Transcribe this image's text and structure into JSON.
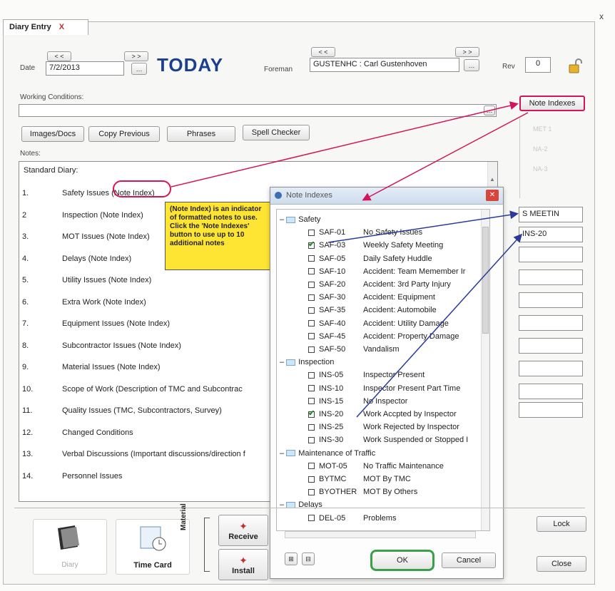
{
  "tab": {
    "label": "Diary Entry",
    "close": "X"
  },
  "window_close": "x",
  "header": {
    "date_label": "Date",
    "date_prev": "< <",
    "date_next": "> >",
    "date_value": "7/2/2013",
    "today_label": "TODAY",
    "foreman_label": "Foreman",
    "foreman_prev": "< <",
    "foreman_next": "> >",
    "foreman_value": "GUSTENHC : Carl Gustenhoven",
    "rev_label": "Rev",
    "rev_value": "0"
  },
  "working_conditions_label": "Working Conditions:",
  "toolbar": {
    "images_docs": "Images/Docs",
    "copy_previous": "Copy Previous",
    "phrases": "Phrases",
    "spell_checker": "Spell Checker"
  },
  "note_indexes_button": "Note Indexes",
  "notes_label": "Notes:",
  "standard_diary": "Standard Diary:",
  "notes": [
    {
      "num": "1.",
      "text": "Safety Issues (Note Index)"
    },
    {
      "num": "2",
      "text": "Inspection (Note Index)"
    },
    {
      "num": "3.",
      "text": "MOT Issues (Note Index)"
    },
    {
      "num": "4.",
      "text": "Delays (Note Index)"
    },
    {
      "num": "5.",
      "text": "Utility Issues (Note Index)"
    },
    {
      "num": "6.",
      "text": "Extra Work (Note Index)"
    },
    {
      "num": "7.",
      "text": "Equipment Issues (Note Index)"
    },
    {
      "num": "8.",
      "text": "Subcontractor Issues (Note Index)"
    },
    {
      "num": "9.",
      "text": "Material Issues (Note Index)"
    },
    {
      "num": "10.",
      "text": "Scope of Work (Description of TMC and Subcontrac"
    },
    {
      "num": "11.",
      "text": "Quality Issues (TMC, Subcontractors, Survey)"
    },
    {
      "num": "12.",
      "text": "Changed Conditions"
    },
    {
      "num": "13.",
      "text": "Verbal Discussions (Important discussions/direction f"
    },
    {
      "num": "14.",
      "text": "Personnel Issues"
    }
  ],
  "callout": "(Note Index) is an indicator of formatted notes to use. Click the 'Note Indexes' button to use up to 10 additional notes",
  "side_slots": [
    "S MEETIN",
    "INS-20"
  ],
  "side_faint": [
    "MET 1",
    "NA-2",
    "NA-3"
  ],
  "dialog": {
    "title": "Note Indexes",
    "close": "✕",
    "items": [
      {
        "kind": "group",
        "label": "Safety"
      },
      {
        "kind": "item",
        "code": "SAF-01",
        "label": "No Safety Issues",
        "checked": false
      },
      {
        "kind": "item",
        "code": "SAF-03",
        "label": "Weekly Safety Meeting",
        "checked": true
      },
      {
        "kind": "item",
        "code": "SAF-05",
        "label": "Daily Safety Huddle",
        "checked": false
      },
      {
        "kind": "item",
        "code": "SAF-10",
        "label": "Accident: Team Memember Ir",
        "checked": false
      },
      {
        "kind": "item",
        "code": "SAF-20",
        "label": "Accident: 3rd Party Injury",
        "checked": false
      },
      {
        "kind": "item",
        "code": "SAF-30",
        "label": "Accident: Equipment",
        "checked": false
      },
      {
        "kind": "item",
        "code": "SAF-35",
        "label": "Accident: Automobile",
        "checked": false
      },
      {
        "kind": "item",
        "code": "SAF-40",
        "label": "Accident: Utility Damage",
        "checked": false
      },
      {
        "kind": "item",
        "code": "SAF-45",
        "label": "Accident: Property Damage",
        "checked": false
      },
      {
        "kind": "item",
        "code": "SAF-50",
        "label": "Vandalism",
        "checked": false
      },
      {
        "kind": "group",
        "label": "Inspection"
      },
      {
        "kind": "item",
        "code": "INS-05",
        "label": "Inspector Present",
        "checked": false
      },
      {
        "kind": "item",
        "code": "INS-10",
        "label": "Inspector Present Part Time",
        "checked": false
      },
      {
        "kind": "item",
        "code": "INS-15",
        "label": "No Inspector",
        "checked": false
      },
      {
        "kind": "item",
        "code": "INS-20",
        "label": "Work Accpted by Inspector",
        "checked": true
      },
      {
        "kind": "item",
        "code": "INS-25",
        "label": "Work Rejected by Inspector",
        "checked": false
      },
      {
        "kind": "item",
        "code": "INS-30",
        "label": "Work Suspended or Stopped I",
        "checked": false
      },
      {
        "kind": "group",
        "label": "Maintenance of Traffic"
      },
      {
        "kind": "item",
        "code": "MOT-05",
        "label": "No Traffic Maintenance",
        "checked": false
      },
      {
        "kind": "item",
        "code": "BYTMC",
        "label": "MOT By TMC",
        "checked": false
      },
      {
        "kind": "item",
        "code": "BYOTHER",
        "label": "MOT By Others",
        "checked": false
      },
      {
        "kind": "group",
        "label": "Delays"
      },
      {
        "kind": "item",
        "code": "DEL-05",
        "label": "Problems",
        "checked": false
      }
    ],
    "ok": "OK",
    "cancel": "Cancel"
  },
  "bottom": {
    "diary": "Diary",
    "time_card": "Time Card",
    "material": "Material",
    "receive": "Receive",
    "install": "Install",
    "lock": "Lock",
    "close": "Close"
  },
  "colors": {
    "annotation_red": "#d4145a",
    "annotation_blue": "#2b3a9a",
    "ok_highlight": "#3aa04a",
    "callout_bg": "#ffe533",
    "today_blue": "#1b3f8f"
  }
}
